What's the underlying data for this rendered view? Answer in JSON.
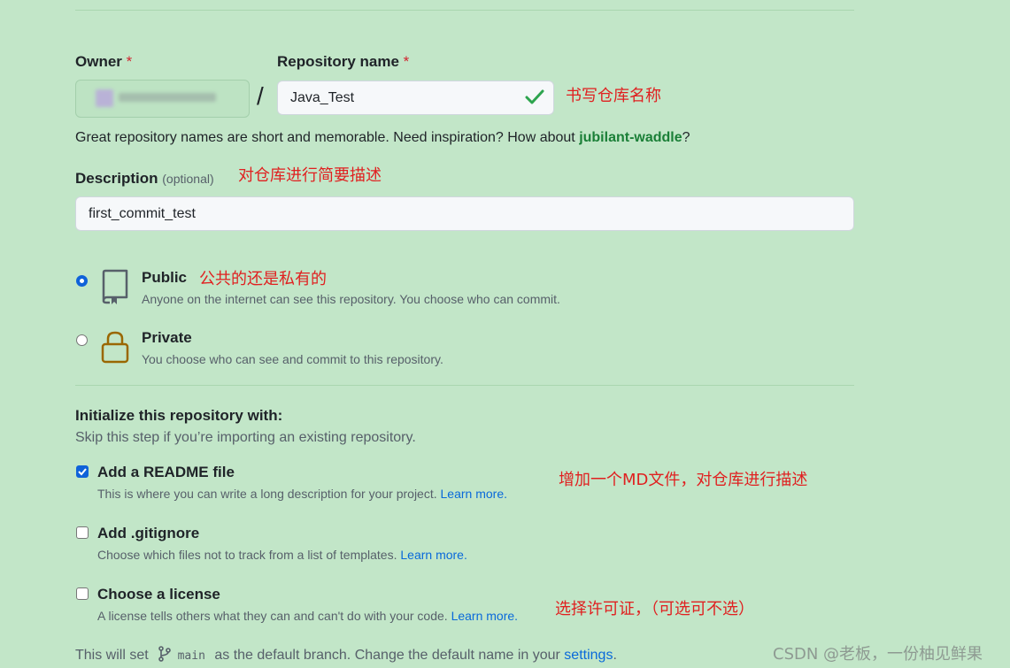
{
  "owner": {
    "label": "Owner",
    "required_mark": "*"
  },
  "repo": {
    "label": "Repository name",
    "required_mark": "*",
    "value": "Java_Test",
    "annotation": "书写仓库名称"
  },
  "separator": "/",
  "hint": {
    "text": "Great repository names are short and memorable. Need inspiration? How about ",
    "suggestion": "jubilant-waddle",
    "suffix": "?"
  },
  "description": {
    "label": "Description",
    "optional": "(optional)",
    "value": "first_commit_test",
    "annotation": "对仓库进行简要描述"
  },
  "visibility": {
    "annotation": "公共的还是私有的",
    "options": [
      {
        "title": "Public",
        "desc": "Anyone on the internet can see this repository. You choose who can commit.",
        "selected": true
      },
      {
        "title": "Private",
        "desc": "You choose who can see and commit to this repository.",
        "selected": false
      }
    ]
  },
  "init": {
    "title": "Initialize this repository with:",
    "subtitle": "Skip this step if you’re importing an existing repository.",
    "items": [
      {
        "title": "Add a README file",
        "desc": "This is where you can write a long description for your project.",
        "link": "Learn more.",
        "checked": true,
        "annotation": "增加一个MD文件，对仓库进行描述"
      },
      {
        "title": "Add .gitignore",
        "desc": "Choose which files not to track from a list of templates.",
        "link": "Learn more.",
        "checked": false
      },
      {
        "title": "Choose a license",
        "desc": "A license tells others what they can and can't do with your code.",
        "link": "Learn more.",
        "checked": false,
        "annotation": "选择许可证，（可选可不选）"
      }
    ]
  },
  "branch": {
    "prefix": "This will set",
    "name": "main",
    "middle": "as the default branch. Change the default name in your",
    "link": "settings",
    "suffix": "."
  },
  "watermark": "CSDN @老板，一份柚见鲜果",
  "colors": {
    "background": "#c2e6c8",
    "link": "#0969da",
    "success": "#1a7f37",
    "annotation": "#e02020"
  }
}
